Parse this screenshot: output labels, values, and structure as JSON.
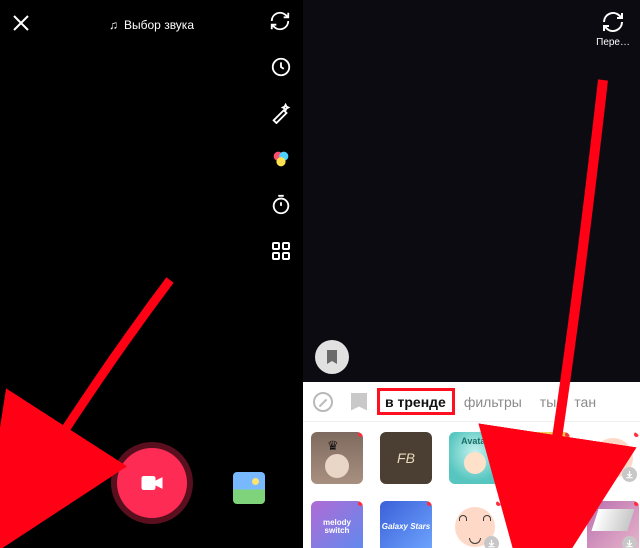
{
  "left": {
    "sound_label": "Выбор звука",
    "tools": [
      "flip",
      "speed",
      "beauty",
      "filters",
      "timer",
      "more"
    ]
  },
  "right": {
    "flip_label": "Пере…",
    "tabs": {
      "none": "",
      "bookmark": "",
      "trending": "в тренде",
      "filters": "фильтры",
      "t4": "ты",
      "t5": "тан"
    },
    "effects": [
      {
        "id": "row1-1",
        "new": true,
        "dl": false,
        "label": ""
      },
      {
        "id": "row1-2",
        "new": false,
        "dl": false,
        "label": "FB"
      },
      {
        "id": "row1-3",
        "new": true,
        "dl": false,
        "label": "Avatar"
      },
      {
        "id": "row1-4",
        "new": true,
        "dl": true,
        "label": ""
      },
      {
        "id": "row1-5",
        "new": true,
        "dl": true,
        "label": ""
      },
      {
        "id": "row2-1",
        "new": true,
        "dl": false,
        "label": "melody switch"
      },
      {
        "id": "row2-2",
        "new": true,
        "dl": false,
        "label": "Galaxy Stars"
      },
      {
        "id": "row2-3",
        "new": true,
        "dl": true,
        "label": ""
      },
      {
        "id": "row2-4",
        "new": true,
        "dl": true,
        "label": ""
      },
      {
        "id": "row2-5",
        "new": true,
        "dl": true,
        "label": ""
      }
    ]
  }
}
